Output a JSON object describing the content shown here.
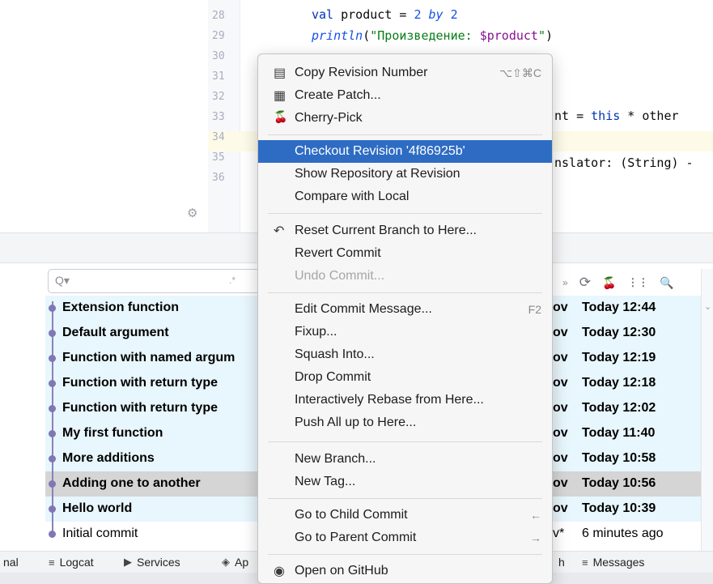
{
  "editor": {
    "line_numbers": [
      "28",
      "29",
      "30",
      "31",
      "32",
      "33",
      "34",
      "35",
      "36"
    ],
    "line28": {
      "kw": "val",
      "name": " product = ",
      "a": "2",
      "op": " by ",
      "b": "2"
    },
    "line29": {
      "fn": "println",
      "open": "(",
      "str_start": "\"Произведение: ",
      "tpl": "$product",
      "str_end": "\"",
      "close": ")"
    },
    "line32_tail": {
      "pre": "nt = ",
      "kw": "this",
      "post": " * other"
    },
    "line34_tail": "nslator: (String) -"
  },
  "log": {
    "search_placeholder": "Q▾",
    "regex_label": ".*",
    "toolbar_icons": [
      "more-icon",
      "refresh-icon",
      "cherry-pick-icon",
      "intellisort-icon",
      "search-icon"
    ],
    "toolbar_glyphs": {
      "more": "»",
      "refresh": "⟳",
      "cherry": "🍒",
      "sort": "⋮⋮",
      "search": "🔍"
    },
    "commits": [
      {
        "subject": "Extension function",
        "author": "ov",
        "time": "Today 12:44"
      },
      {
        "subject": "Default argument",
        "author": "ov",
        "time": "Today 12:30"
      },
      {
        "subject": "Function with named argum",
        "author": "ov",
        "time": "Today 12:19"
      },
      {
        "subject": "Function with return type",
        "author": "ov",
        "time": "Today 12:18"
      },
      {
        "subject": "Function with return type",
        "author": "ov",
        "time": "Today 12:02"
      },
      {
        "subject": "My first function",
        "author": "ov",
        "time": "Today 11:40"
      },
      {
        "subject": "More additions",
        "author": "ov",
        "time": "Today 10:58"
      },
      {
        "subject": "Adding one to another",
        "author": "ov",
        "time": "Today 10:56"
      },
      {
        "subject": "Hello world",
        "author": "ov",
        "time": "Today 10:39"
      },
      {
        "subject": "Initial commit",
        "author": "v*",
        "time": "6 minutes ago"
      }
    ]
  },
  "bottom_bar": {
    "items": [
      {
        "label": "nal",
        "icon": ""
      },
      {
        "label": "Logcat",
        "icon": "≡"
      },
      {
        "label": "Services",
        "icon": "▶"
      },
      {
        "label": "Ap",
        "icon": "◈"
      },
      {
        "label": "h",
        "icon": ""
      },
      {
        "label": "Messages",
        "icon": "≡"
      }
    ]
  },
  "menu": {
    "items": [
      {
        "label": "Copy Revision Number",
        "shortcut": "⌥⇧⌘C",
        "icon": "▤"
      },
      {
        "label": "Create Patch...",
        "icon": "▦"
      },
      {
        "label": "Cherry-Pick",
        "icon": "🍒"
      },
      {
        "label": "Checkout Revision '4f86925b'"
      },
      {
        "label": "Show Repository at Revision"
      },
      {
        "label": "Compare with Local"
      },
      {
        "label": "Reset Current Branch to Here...",
        "icon": "↶"
      },
      {
        "label": "Revert Commit"
      },
      {
        "label": "Undo Commit..."
      },
      {
        "label": "Edit Commit Message...",
        "shortcut": "F2"
      },
      {
        "label": "Fixup..."
      },
      {
        "label": "Squash Into..."
      },
      {
        "label": "Drop Commit"
      },
      {
        "label": "Interactively Rebase from Here..."
      },
      {
        "label": "Push All up to Here..."
      },
      {
        "label": "New Branch..."
      },
      {
        "label": "New Tag..."
      },
      {
        "label": "Go to Child Commit",
        "shortcut": "←"
      },
      {
        "label": "Go to Parent Commit",
        "shortcut": "→"
      },
      {
        "label": "Open on GitHub",
        "icon": "◉"
      }
    ]
  },
  "gear_glyph": "⚙",
  "chevron_glyph": "⌄"
}
